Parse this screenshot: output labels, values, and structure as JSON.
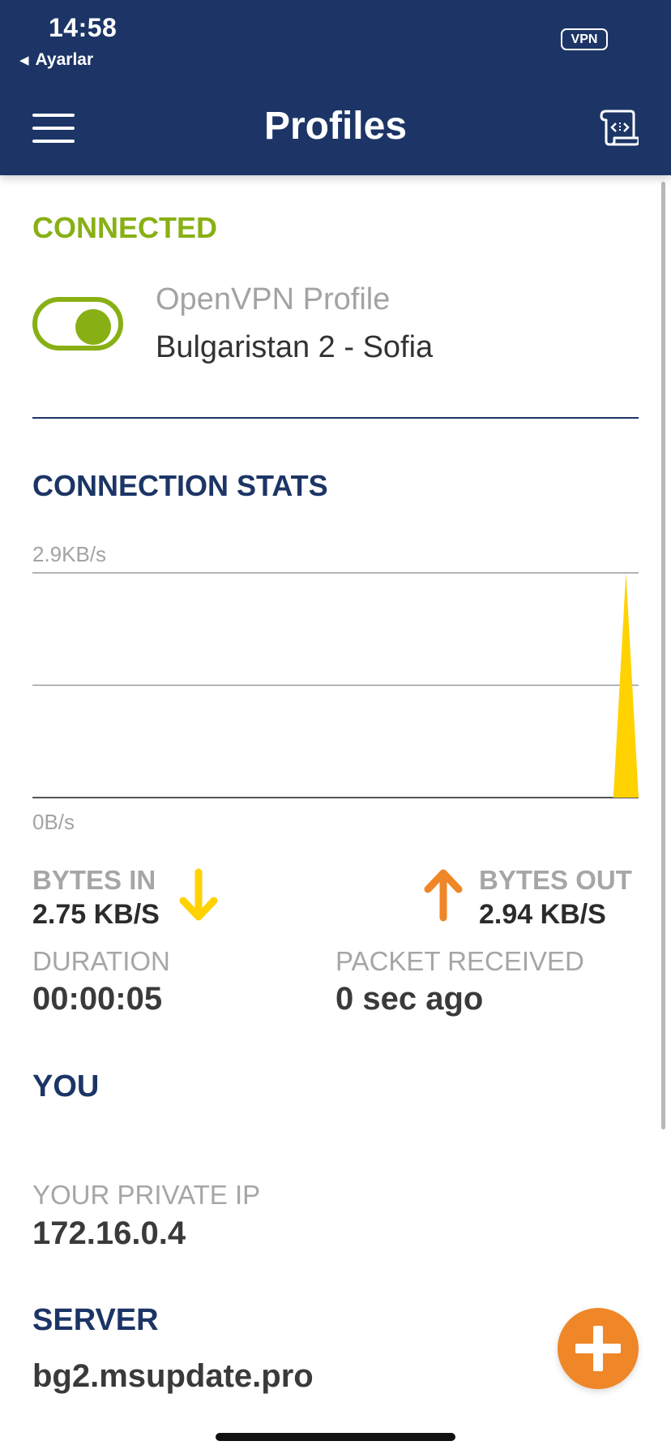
{
  "status_bar": {
    "time": "14:58",
    "back_app": "Ayarlar",
    "vpn_badge": "VPN"
  },
  "header": {
    "title": "Profiles",
    "menu_icon": "hamburger-menu-icon",
    "import_icon": "import-profile-icon"
  },
  "connection": {
    "status": "CONNECTED",
    "toggle_on": true,
    "profile_type": "OpenVPN Profile",
    "profile_name": "Bulgaristan 2 - Sofia"
  },
  "stats": {
    "heading": "CONNECTION STATS",
    "bytes_in_label": "BYTES IN",
    "bytes_in_value": "2.75 KB/S",
    "bytes_out_label": "BYTES OUT",
    "bytes_out_value": "2.94 KB/S",
    "duration_label": "DURATION",
    "duration_value": "00:00:05",
    "packet_label": "PACKET RECEIVED",
    "packet_value": "0 sec ago"
  },
  "chart_data": {
    "type": "area",
    "y_max_label": "2.9KB/s",
    "y_min_label": "0B/s",
    "ylim": [
      0,
      2.9
    ],
    "unit": "KB/s",
    "series": [
      {
        "color": "#ffd200",
        "values": [
          0,
          0,
          0,
          0,
          0,
          0,
          0,
          0,
          0,
          0,
          0,
          0,
          0,
          0,
          0,
          0,
          0,
          0,
          0,
          0,
          0,
          0,
          0,
          0,
          0,
          0,
          0,
          0,
          0,
          0,
          0,
          0,
          0,
          0,
          0,
          0,
          0,
          0,
          0,
          0,
          0,
          0,
          0,
          0,
          0,
          0,
          0,
          2.9,
          0
        ]
      }
    ],
    "grid": true
  },
  "you": {
    "heading": "YOU",
    "private_ip_label": "YOUR PRIVATE IP",
    "private_ip_value": "172.16.0.4"
  },
  "server": {
    "heading": "SERVER",
    "value": "bg2.msupdate.pro"
  },
  "colors": {
    "header_bg": "#1c3566",
    "connected_green": "#88b014",
    "bytes_in_yellow": "#ffd200",
    "bytes_out_orange": "#ef8627",
    "fab_orange": "#ef8627"
  }
}
